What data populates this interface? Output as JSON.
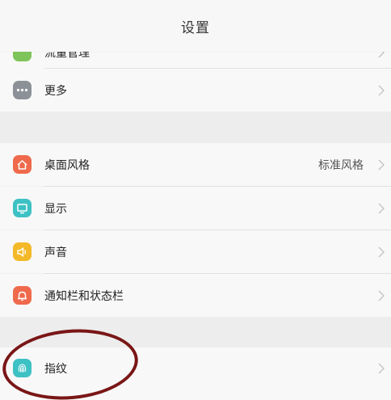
{
  "header": {
    "title": "设置"
  },
  "rows": [
    {
      "label": "流量管理",
      "icon": "data-usage-icon",
      "color": "#7ec45a"
    },
    {
      "label": "更多",
      "icon": "more-dots-icon",
      "color": "#8c9097"
    },
    {
      "label": "桌面风格",
      "value": "标准风格",
      "icon": "home-icon",
      "color": "#ef6a4c"
    },
    {
      "label": "显示",
      "icon": "display-icon",
      "color": "#3dc1c4"
    },
    {
      "label": "声音",
      "icon": "speaker-icon",
      "color": "#f3b928"
    },
    {
      "label": "通知栏和状态栏",
      "icon": "bell-icon",
      "color": "#ef6a4c"
    },
    {
      "label": "指纹",
      "icon": "fingerprint-icon",
      "color": "#3dc1c4"
    }
  ]
}
